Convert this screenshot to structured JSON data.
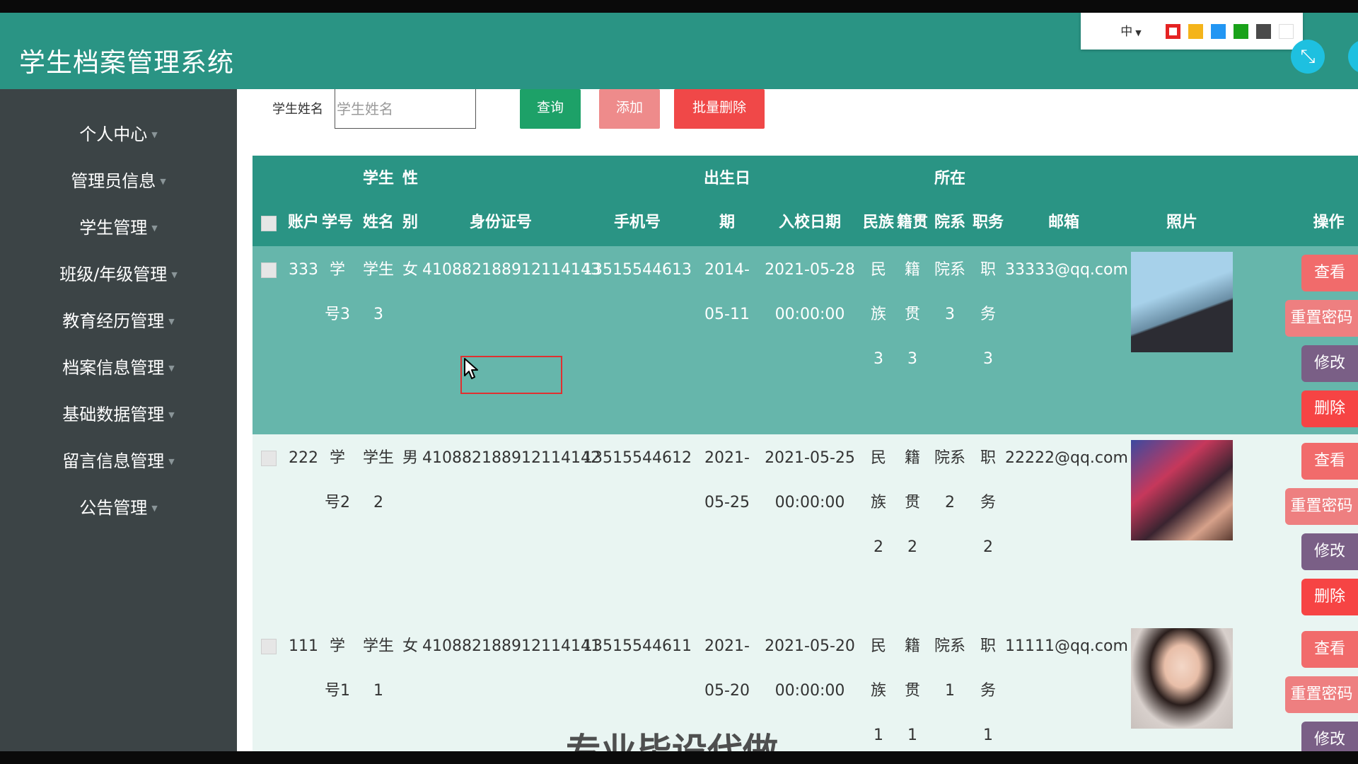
{
  "app": {
    "title": "学生档案管理系统"
  },
  "theme": {
    "language": "中",
    "swatches": [
      "#e52323",
      "#f4b41a",
      "#2296f3",
      "#1aa21a",
      "#4a4a4a",
      "#ffffff"
    ]
  },
  "sidebar": {
    "items": [
      {
        "label": "个人中心"
      },
      {
        "label": "管理员信息"
      },
      {
        "label": "学生管理"
      },
      {
        "label": "班级/年级管理"
      },
      {
        "label": "教育经历管理"
      },
      {
        "label": "档案信息管理"
      },
      {
        "label": "基础数据管理"
      },
      {
        "label": "留言信息管理"
      },
      {
        "label": "公告管理"
      }
    ]
  },
  "search": {
    "label": "学生姓名",
    "placeholder": "学生姓名",
    "value": ""
  },
  "toolbar": {
    "query_label": "查询",
    "add_label": "添加",
    "batch_delete_label": "批量删除"
  },
  "table": {
    "headers": {
      "account": "账户",
      "student_no": "学号",
      "name_top": "学生",
      "name_bottom": "姓名",
      "gender_top": "性",
      "gender_bottom": "别",
      "id_card": "身份证号",
      "phone": "手机号",
      "birth_top": "出生日",
      "birth_bottom": "期",
      "enroll_date": "入校日期",
      "ethnicity": "民族",
      "native_place": "籍贯",
      "dept_top": "所在",
      "dept_bottom": "院系",
      "position": "职务",
      "email": "邮箱",
      "photo": "照片",
      "actions": "操作"
    },
    "rows": [
      {
        "account": "333",
        "student_no_1": "学",
        "student_no_2": "号3",
        "name_1": "学生",
        "name_2": "3",
        "gender": "女",
        "id_card": "410882188912114143",
        "phone": "13515544613",
        "birth_1": "2014-",
        "birth_2": "05-11",
        "enroll_1": "2021-05-28",
        "enroll_2": "00:00:00",
        "ethnicity_1": "民",
        "ethnicity_2": "族",
        "ethnicity_3": "3",
        "native_1": "籍",
        "native_2": "贯",
        "native_3": "3",
        "dept_1": "院系",
        "dept_2": "3",
        "position_1": "职",
        "position_2": "务",
        "position_3": "3",
        "email": "33333@qq.com"
      },
      {
        "account": "222",
        "student_no_1": "学",
        "student_no_2": "号2",
        "name_1": "学生",
        "name_2": "2",
        "gender": "男",
        "id_card": "410882188912114142",
        "phone": "13515544612",
        "birth_1": "2021-",
        "birth_2": "05-25",
        "enroll_1": "2021-05-25",
        "enroll_2": "00:00:00",
        "ethnicity_1": "民",
        "ethnicity_2": "族",
        "ethnicity_3": "2",
        "native_1": "籍",
        "native_2": "贯",
        "native_3": "2",
        "dept_1": "院系",
        "dept_2": "2",
        "position_1": "职",
        "position_2": "务",
        "position_3": "2",
        "email": "22222@qq.com"
      },
      {
        "account": "111",
        "student_no_1": "学",
        "student_no_2": "号1",
        "name_1": "学生",
        "name_2": "1",
        "gender": "女",
        "id_card": "410882188912114141",
        "phone": "13515544611",
        "birth_1": "2021-",
        "birth_2": "05-20",
        "enroll_1": "2021-05-20",
        "enroll_2": "00:00:00",
        "ethnicity_1": "民",
        "ethnicity_2": "族",
        "ethnicity_3": "1",
        "native_1": "籍",
        "native_2": "贯",
        "native_3": "1",
        "dept_1": "院系",
        "dept_2": "1",
        "position_1": "职",
        "position_2": "务",
        "position_3": "1",
        "email": "11111@qq.com"
      }
    ],
    "actions": {
      "view": "查看",
      "reset_password": "重置密码",
      "edit": "修改",
      "delete": "删除"
    }
  },
  "overlay": {
    "caption": "专业毕设代做"
  }
}
